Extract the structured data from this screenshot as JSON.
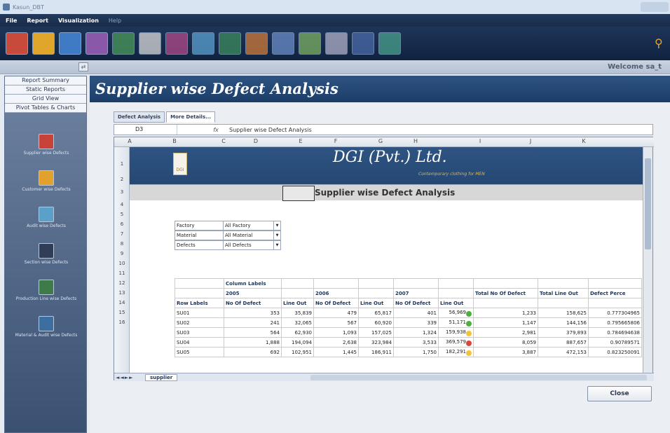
{
  "window": {
    "title": "Kasun_DBT"
  },
  "menu": {
    "items": [
      "File",
      "Report",
      "Visualization",
      "Help"
    ]
  },
  "toolbar": {
    "buttons": [
      "view-icon",
      "bar-chart-icon",
      "monitor-icon",
      "chart-3d-icon",
      "pie-chart-icon",
      "map-icon",
      "column-chart-icon",
      "cube-icon",
      "line-chart-icon",
      "grid-chart-icon",
      "area-chart-icon",
      "trend-chart-icon",
      "filter-chart-icon",
      "help-icon",
      "map2-icon"
    ],
    "colors": [
      "#c84a3a",
      "#e0a62c",
      "#3e7bc4",
      "#8a58a8",
      "#4a9a5a",
      "#d9d9d9",
      "#b04a8a",
      "#5aa0d0",
      "#3d8b5d",
      "#cf7a38",
      "#6a8cc8",
      "#7bb062",
      "#b0b0c8",
      "#4a6aa8",
      "#48a08c"
    ]
  },
  "header": {
    "welcome": "Welcome  sa_t"
  },
  "sidebar": {
    "nav": [
      "Report Summary",
      "Static Reports",
      "Grid View",
      "Pivot Tables & Charts"
    ],
    "items": [
      "Supplier wise Defects",
      "Customer wise Defects",
      "Audit wise Defects",
      "Section wise Defects",
      "Production Line wise Defects",
      "Material & Audit wise Defects"
    ]
  },
  "main": {
    "title": "Supplier wise Defect Analysis",
    "tabs": [
      "Defect Analysis",
      "More Details..."
    ],
    "formula": {
      "cell": "D3",
      "content": "Supplier wise Defect Analysis"
    },
    "columns": [
      "A",
      "B",
      "C",
      "D",
      "E",
      "F",
      "G",
      "H",
      "I",
      "J",
      "K"
    ],
    "rows": [
      "1",
      "2",
      "3",
      "4",
      "5",
      "6",
      "7",
      "8",
      "9",
      "10",
      "11",
      "12",
      "13",
      "14",
      "15",
      "16"
    ],
    "company": "DGI (Pvt.) Ltd.",
    "logo_text": "DGI",
    "tagline": "Contemporary clothing for MEN",
    "report_title": "Supplier wise Defect Analysis",
    "filters": [
      {
        "label": "Factory",
        "value": "All Factory"
      },
      {
        "label": "Material",
        "value": "All Material"
      },
      {
        "label": "Defects",
        "value": "All Defects"
      }
    ],
    "pivot": {
      "column_labels": "Column Labels",
      "years": [
        "2005",
        "2006",
        "2007"
      ],
      "headers": [
        "Row Labels",
        "No Of Defect",
        "Line Out",
        "No Of Defect",
        "Line Out",
        "No Of Defect",
        "Line Out",
        "Total No Of Defect",
        "Total Line Out",
        "Defect Perce"
      ],
      "rows": [
        {
          "label": "SU01",
          "v": [
            "353",
            "35,839",
            "479",
            "65,817",
            "401",
            "56,969",
            "1,233",
            "158,625",
            "0.777304965"
          ],
          "status": "green"
        },
        {
          "label": "SU02",
          "v": [
            "241",
            "32,065",
            "567",
            "60,920",
            "339",
            "51,171",
            "1,147",
            "144,156",
            "0.795665806"
          ],
          "status": "green"
        },
        {
          "label": "SU03",
          "v": [
            "564",
            "62,930",
            "1,093",
            "157,025",
            "1,324",
            "159,938",
            "2,981",
            "379,893",
            "0.784694638"
          ],
          "status": "yellow"
        },
        {
          "label": "SU04",
          "v": [
            "1,888",
            "194,094",
            "2,638",
            "323,984",
            "3,533",
            "369,579",
            "8,059",
            "887,657",
            "0.90789571"
          ],
          "status": "red"
        },
        {
          "label": "SU05",
          "v": [
            "692",
            "102,951",
            "1,445",
            "186,911",
            "1,750",
            "182,291",
            "3,887",
            "472,153",
            "0.823250091"
          ],
          "status": "yellow"
        }
      ]
    },
    "sheet_tab": "supplier",
    "close_label": "Close"
  },
  "status_colors": {
    "green": "#4caf3e",
    "yellow": "#f0c53a",
    "red": "#d9473b"
  }
}
